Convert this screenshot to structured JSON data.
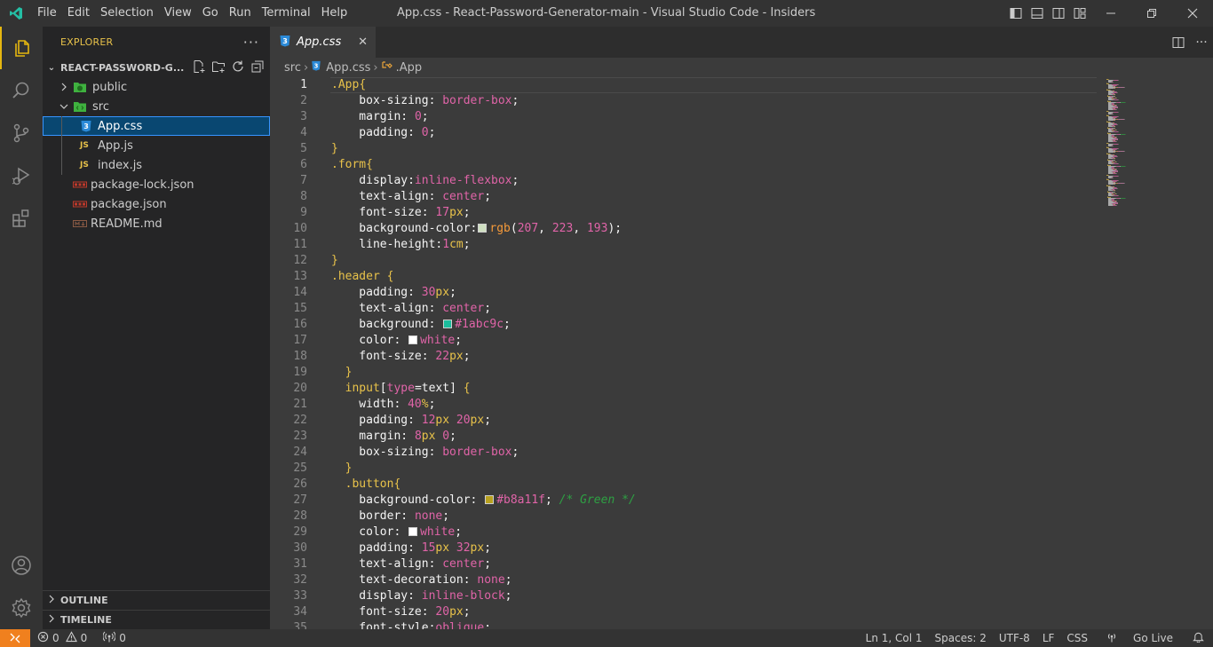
{
  "titlebar": {
    "menu": [
      "File",
      "Edit",
      "Selection",
      "View",
      "Go",
      "Run",
      "Terminal",
      "Help"
    ],
    "title": "App.css - React-Password-Generator-main - Visual Studio Code - Insiders"
  },
  "sidebar": {
    "title": "EXPLORER",
    "project": "REACT-PASSWORD-G...",
    "tree": [
      {
        "label": "public",
        "type": "folder",
        "collapsed": true
      },
      {
        "label": "src",
        "type": "folder",
        "collapsed": false
      },
      {
        "label": "App.css",
        "type": "css",
        "selected": true
      },
      {
        "label": "App.js",
        "type": "js"
      },
      {
        "label": "index.js",
        "type": "js"
      },
      {
        "label": "package-lock.json",
        "type": "json"
      },
      {
        "label": "package.json",
        "type": "json"
      },
      {
        "label": "README.md",
        "type": "md"
      }
    ],
    "outline": "OUTLINE",
    "timeline": "TIMELINE"
  },
  "tab": {
    "label": "App.css",
    "icon": "css-file-icon"
  },
  "breadcrumb": {
    "folder": "src",
    "file": "App.css",
    "symbol": ".App"
  },
  "code": [
    {
      "n": "1",
      "parts": [
        [
          "sel-c",
          ".App"
        ],
        [
          "br",
          "{"
        ]
      ]
    },
    {
      "n": "2",
      "parts": [
        [
          "prop",
          "    box-sizing"
        ],
        [
          "pn",
          ": "
        ],
        [
          "kw",
          "border-box"
        ],
        [
          "pn",
          ";"
        ]
      ]
    },
    {
      "n": "3",
      "parts": [
        [
          "prop",
          "    margin"
        ],
        [
          "pn",
          ": "
        ],
        [
          "num",
          "0"
        ],
        [
          "pn",
          ";"
        ]
      ]
    },
    {
      "n": "4",
      "parts": [
        [
          "prop",
          "    padding"
        ],
        [
          "pn",
          ": "
        ],
        [
          "num",
          "0"
        ],
        [
          "pn",
          ";"
        ]
      ]
    },
    {
      "n": "5",
      "parts": [
        [
          "br",
          "}"
        ]
      ]
    },
    {
      "n": "6",
      "parts": [
        [
          "sel-c",
          ".form"
        ],
        [
          "br",
          "{"
        ]
      ]
    },
    {
      "n": "7",
      "parts": [
        [
          "prop",
          "    display"
        ],
        [
          "pn",
          ":"
        ],
        [
          "kw",
          "inline-flexbox"
        ],
        [
          "pn",
          ";"
        ]
      ]
    },
    {
      "n": "8",
      "parts": [
        [
          "prop",
          "    text-align"
        ],
        [
          "pn",
          ": "
        ],
        [
          "kw",
          "center"
        ],
        [
          "pn",
          ";"
        ]
      ]
    },
    {
      "n": "9",
      "parts": [
        [
          "prop",
          "    font-size"
        ],
        [
          "pn",
          ": "
        ],
        [
          "num",
          "17"
        ],
        [
          "unit",
          "px"
        ],
        [
          "pn",
          ";"
        ]
      ]
    },
    {
      "n": "10",
      "parts": [
        [
          "prop",
          "    background-color"
        ],
        [
          "pn",
          ":"
        ],
        [
          "swatch",
          "#cfdfc1"
        ],
        [
          "fn",
          "rgb"
        ],
        [
          "pn",
          "("
        ],
        [
          "num",
          "207"
        ],
        [
          "pn",
          ", "
        ],
        [
          "num",
          "223"
        ],
        [
          "pn",
          ", "
        ],
        [
          "num",
          "193"
        ],
        [
          "pn",
          ");"
        ]
      ]
    },
    {
      "n": "11",
      "parts": [
        [
          "prop",
          "    line-height"
        ],
        [
          "pn",
          ":"
        ],
        [
          "num",
          "1"
        ],
        [
          "unit",
          "cm"
        ],
        [
          "pn",
          ";"
        ]
      ]
    },
    {
      "n": "12",
      "parts": [
        [
          "br",
          "}"
        ]
      ]
    },
    {
      "n": "13",
      "parts": [
        [
          "sel-c",
          ".header "
        ],
        [
          "br",
          "{"
        ]
      ]
    },
    {
      "n": "14",
      "parts": [
        [
          "prop",
          "    padding"
        ],
        [
          "pn",
          ": "
        ],
        [
          "num",
          "30"
        ],
        [
          "unit",
          "px"
        ],
        [
          "pn",
          ";"
        ]
      ]
    },
    {
      "n": "15",
      "parts": [
        [
          "prop",
          "    text-align"
        ],
        [
          "pn",
          ": "
        ],
        [
          "kw",
          "center"
        ],
        [
          "pn",
          ";"
        ]
      ]
    },
    {
      "n": "16",
      "parts": [
        [
          "prop",
          "    background"
        ],
        [
          "pn",
          ": "
        ],
        [
          "swatch",
          "#1abc9c"
        ],
        [
          "kw",
          "#1abc9c"
        ],
        [
          "pn",
          ";"
        ]
      ]
    },
    {
      "n": "17",
      "parts": [
        [
          "prop",
          "    color"
        ],
        [
          "pn",
          ": "
        ],
        [
          "swatch",
          "#ffffff"
        ],
        [
          "kw",
          "white"
        ],
        [
          "pn",
          ";"
        ]
      ]
    },
    {
      "n": "18",
      "parts": [
        [
          "prop",
          "    font-size"
        ],
        [
          "pn",
          ": "
        ],
        [
          "num",
          "22"
        ],
        [
          "unit",
          "px"
        ],
        [
          "pn",
          ";"
        ]
      ]
    },
    {
      "n": "19",
      "parts": [
        [
          "br",
          "  }"
        ]
      ]
    },
    {
      "n": "20",
      "parts": [
        [
          "sel-c",
          "  input"
        ],
        [
          "pn",
          "["
        ],
        [
          "kw",
          "type"
        ],
        [
          "pn",
          "="
        ],
        [
          "pn",
          "text"
        ],
        [
          "pn",
          "] "
        ],
        [
          "br",
          "{"
        ]
      ]
    },
    {
      "n": "21",
      "parts": [
        [
          "prop",
          "    width"
        ],
        [
          "pn",
          ": "
        ],
        [
          "num",
          "40"
        ],
        [
          "unit",
          "%"
        ],
        [
          "pn",
          ";"
        ]
      ]
    },
    {
      "n": "22",
      "parts": [
        [
          "prop",
          "    padding"
        ],
        [
          "pn",
          ": "
        ],
        [
          "num",
          "12"
        ],
        [
          "unit",
          "px"
        ],
        [
          "pn",
          " "
        ],
        [
          "num",
          "20"
        ],
        [
          "unit",
          "px"
        ],
        [
          "pn",
          ";"
        ]
      ]
    },
    {
      "n": "23",
      "parts": [
        [
          "prop",
          "    margin"
        ],
        [
          "pn",
          ": "
        ],
        [
          "num",
          "8"
        ],
        [
          "unit",
          "px"
        ],
        [
          "pn",
          " "
        ],
        [
          "num",
          "0"
        ],
        [
          "pn",
          ";"
        ]
      ]
    },
    {
      "n": "24",
      "parts": [
        [
          "prop",
          "    box-sizing"
        ],
        [
          "pn",
          ": "
        ],
        [
          "kw",
          "border-box"
        ],
        [
          "pn",
          ";"
        ]
      ]
    },
    {
      "n": "25",
      "parts": [
        [
          "br",
          "  }"
        ]
      ]
    },
    {
      "n": "26",
      "parts": [
        [
          "sel-c",
          "  .button"
        ],
        [
          "br",
          "{"
        ]
      ]
    },
    {
      "n": "27",
      "parts": [
        [
          "prop",
          "    background-color"
        ],
        [
          "pn",
          ": "
        ],
        [
          "swatch",
          "#b8a11f"
        ],
        [
          "kw",
          "#b8a11f"
        ],
        [
          "pn",
          "; "
        ],
        [
          "cm",
          "/* Green */"
        ]
      ]
    },
    {
      "n": "28",
      "parts": [
        [
          "prop",
          "    border"
        ],
        [
          "pn",
          ": "
        ],
        [
          "kw",
          "none"
        ],
        [
          "pn",
          ";"
        ]
      ]
    },
    {
      "n": "29",
      "parts": [
        [
          "prop",
          "    color"
        ],
        [
          "pn",
          ": "
        ],
        [
          "swatch",
          "#ffffff"
        ],
        [
          "kw",
          "white"
        ],
        [
          "pn",
          ";"
        ]
      ]
    },
    {
      "n": "30",
      "parts": [
        [
          "prop",
          "    padding"
        ],
        [
          "pn",
          ": "
        ],
        [
          "num",
          "15"
        ],
        [
          "unit",
          "px"
        ],
        [
          "pn",
          " "
        ],
        [
          "num",
          "32"
        ],
        [
          "unit",
          "px"
        ],
        [
          "pn",
          ";"
        ]
      ]
    },
    {
      "n": "31",
      "parts": [
        [
          "prop",
          "    text-align"
        ],
        [
          "pn",
          ": "
        ],
        [
          "kw",
          "center"
        ],
        [
          "pn",
          ";"
        ]
      ]
    },
    {
      "n": "32",
      "parts": [
        [
          "prop",
          "    text-decoration"
        ],
        [
          "pn",
          ": "
        ],
        [
          "kw",
          "none"
        ],
        [
          "pn",
          ";"
        ]
      ]
    },
    {
      "n": "33",
      "parts": [
        [
          "prop",
          "    display"
        ],
        [
          "pn",
          ": "
        ],
        [
          "kw",
          "inline-block"
        ],
        [
          "pn",
          ";"
        ]
      ]
    },
    {
      "n": "34",
      "parts": [
        [
          "prop",
          "    font-size"
        ],
        [
          "pn",
          ": "
        ],
        [
          "num",
          "20"
        ],
        [
          "unit",
          "px"
        ],
        [
          "pn",
          ";"
        ]
      ]
    },
    {
      "n": "35",
      "parts": [
        [
          "prop",
          "    font-style"
        ],
        [
          "pn",
          ":"
        ],
        [
          "kw",
          "oblique"
        ],
        [
          "pn",
          ";"
        ]
      ]
    }
  ],
  "status": {
    "errors": "0",
    "warnings": "0",
    "ports": "0",
    "position": "Ln 1, Col 1",
    "spaces": "Spaces: 2",
    "encoding": "UTF-8",
    "eol": "LF",
    "language": "CSS",
    "golive": "Go Live"
  },
  "colors": {
    "accent": "#e5b710",
    "selection": "#094771",
    "remote": "#f0801e",
    "editor_bg": "#3b3b3b"
  }
}
